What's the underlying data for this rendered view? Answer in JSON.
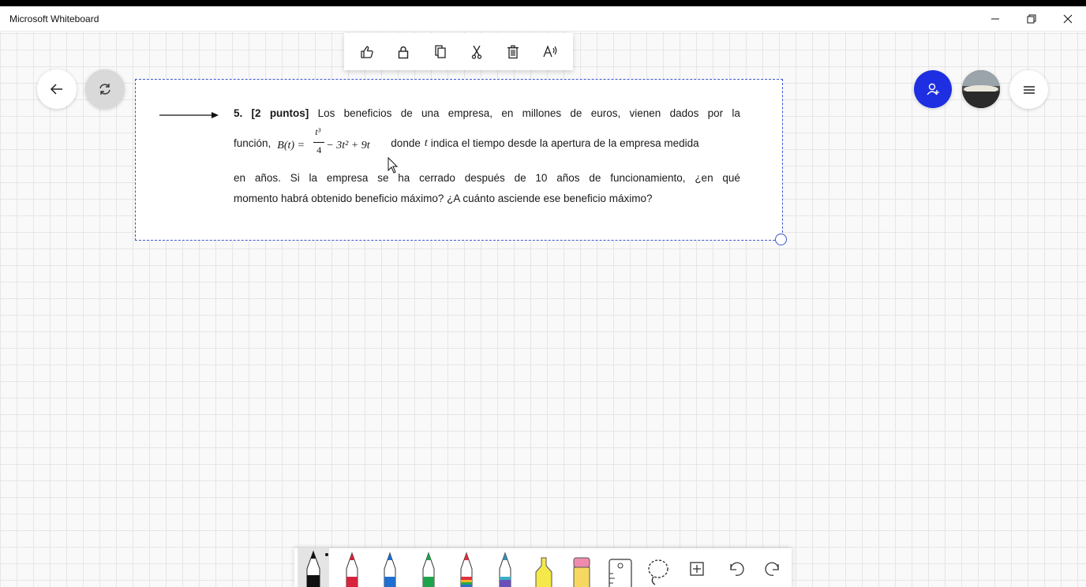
{
  "window": {
    "title": "Microsoft Whiteboard"
  },
  "context_toolbar": [
    {
      "name": "react",
      "icon": "thumbs-up-icon"
    },
    {
      "name": "lock",
      "icon": "lock-icon"
    },
    {
      "name": "copy",
      "icon": "copy-icon"
    },
    {
      "name": "cut",
      "icon": "scissors-icon"
    },
    {
      "name": "delete",
      "icon": "trash-icon"
    },
    {
      "name": "read-aloud",
      "icon": "read-aloud-icon"
    }
  ],
  "problem": {
    "line1": [
      "5.",
      "[2",
      "puntos]",
      "Los",
      "beneficios",
      "de",
      "una",
      "empresa,",
      "en",
      "millones",
      "de",
      "euros,",
      "vienen",
      "dados",
      "por",
      "la"
    ],
    "line2_prefix": "función,",
    "formula": {
      "lhs": "B(t) =",
      "numerator": "t³",
      "denominator": "4",
      "rest": "− 3t² + 9t"
    },
    "line2_suffix_before_var": "donde",
    "line2_var": "t",
    "line2_suffix_after_var": "indica el tiempo desde la apertura de la empresa medida",
    "line3": [
      "en",
      "años.",
      "Si",
      "la",
      "empresa",
      "se",
      "ha",
      "cerrado",
      "después",
      "de",
      "10",
      "años",
      "de",
      "funcionamiento,",
      "¿en",
      "qué"
    ],
    "line4": "momento habrá obtenido beneficio máximo? ¿A cuánto asciende ese beneficio máximo?"
  },
  "tools": [
    {
      "name": "pen-black",
      "color": "#111111",
      "selected": true
    },
    {
      "name": "pen-red",
      "color": "#d6243d"
    },
    {
      "name": "pen-blue",
      "color": "#1f6fd0"
    },
    {
      "name": "pen-green",
      "color": "#1ea54a"
    },
    {
      "name": "pen-rainbow",
      "color": "#e0303a"
    },
    {
      "name": "pen-galaxy",
      "color": "#3a8fb5"
    },
    {
      "name": "highlighter-yellow",
      "color": "#f5e84a"
    },
    {
      "name": "eraser",
      "color": "#f08bb0"
    },
    {
      "name": "ruler",
      "color": "#ffffff"
    },
    {
      "name": "lasso-select",
      "color": "#ffffff"
    },
    {
      "name": "add-tool",
      "color": "#ffffff"
    },
    {
      "name": "undo",
      "color": "#ffffff"
    },
    {
      "name": "redo",
      "color": "#ffffff"
    }
  ]
}
